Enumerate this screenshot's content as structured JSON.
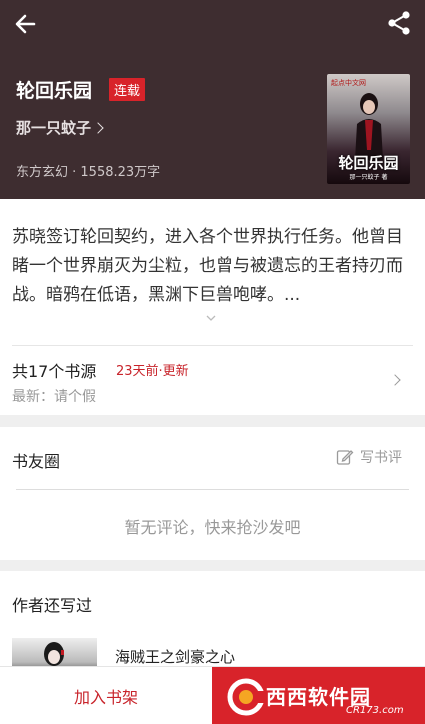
{
  "header": {
    "book_title": "轮回乐园",
    "status_badge": "连载",
    "author": "那一只蚊子",
    "meta": "东方玄幻 · 1558.23万字",
    "cover": {
      "publisher": "起点中文网",
      "title": "轮回乐园",
      "author": "那一只蚊子 著"
    }
  },
  "synopsis": {
    "text": "苏晓签订轮回契约，进入各个世界执行任务。他曾目睹一个世界崩灭为尘粒，也曾与被遗忘的王者持刃而战。暗鸦在低语，黑渊下巨兽咆哮。..."
  },
  "sources": {
    "title": "共17个书源",
    "updated": "23天前·更新",
    "latest": "最新：请个假"
  },
  "friends": {
    "title": "书友圈",
    "write_review": "写书评",
    "empty": "暂无评论，快来抢沙发吧"
  },
  "also_wrote": {
    "title": "作者还写过",
    "book_title": "海贼王之剑豪之心"
  },
  "bottom_bar": {
    "add_shelf": "加入书架"
  },
  "watermark": {
    "text": "西西软件园",
    "sub": "CR173.com"
  },
  "colors": {
    "header_bg": "#3e2d30",
    "accent_red": "#d8232a"
  }
}
